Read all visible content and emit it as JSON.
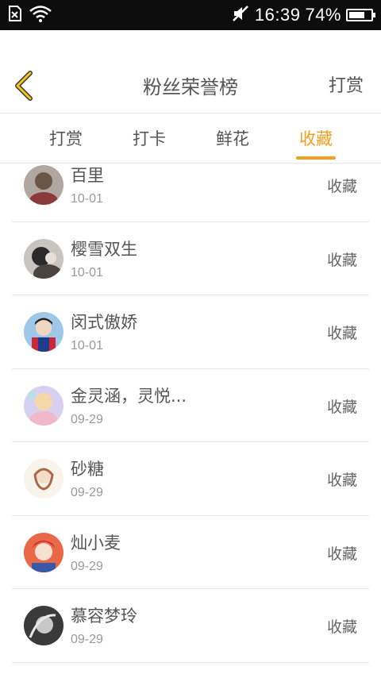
{
  "status": {
    "time": "16:39",
    "battery_percent": "74%",
    "battery_level": 0.74
  },
  "header": {
    "title": "粉丝荣誉榜",
    "action_label": "打赏",
    "back_icon": "chevron-left-icon",
    "accent_color": "#f0a01e"
  },
  "tabs": [
    {
      "label": "打赏",
      "active": false
    },
    {
      "label": "打卡",
      "active": false
    },
    {
      "label": "鲜花",
      "active": false
    },
    {
      "label": "收藏",
      "active": true
    }
  ],
  "fans": [
    {
      "name": "百里",
      "date": "10-01",
      "action": "收藏"
    },
    {
      "name": "樱雪双生",
      "date": "10-01",
      "action": "收藏"
    },
    {
      "name": "闵式傲娇",
      "date": "10-01",
      "action": "收藏"
    },
    {
      "name": "金灵涵，灵悦...",
      "date": "09-29",
      "action": "收藏"
    },
    {
      "name": "砂糖",
      "date": "09-29",
      "action": "收藏"
    },
    {
      "name": "灿小麦",
      "date": "09-29",
      "action": "收藏"
    },
    {
      "name": "慕容梦玲",
      "date": "09-29",
      "action": "收藏"
    }
  ]
}
